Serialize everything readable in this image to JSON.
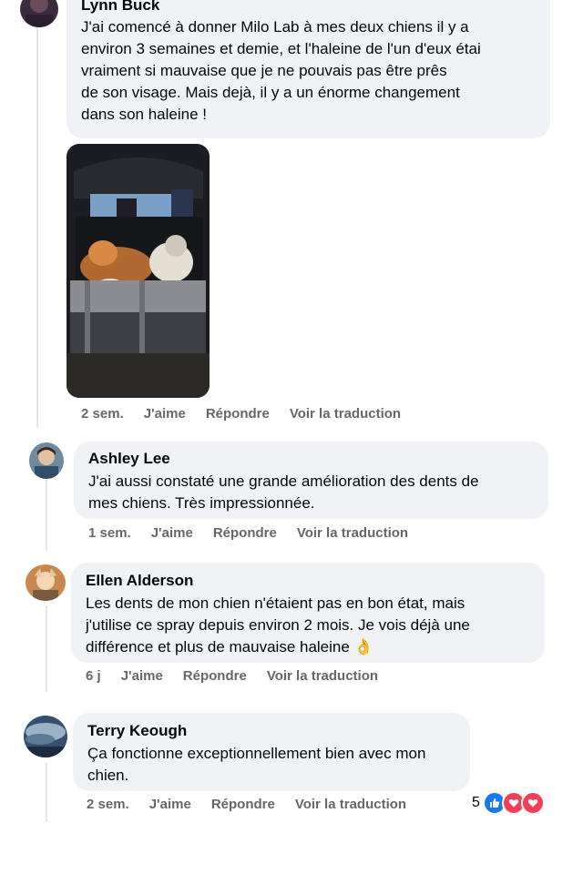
{
  "comments": [
    {
      "author": "Lynn Buck",
      "lines": [
        "J'ai comencé à donner Milo Lab à mes deux chiens il y a",
        "environ 3 semaines et demie, et l'haleine de l'un d'eux étai",
        "vraiment si mauvaise que je ne pouvais pas être prês",
        "de son visage. Mais dejà, il y a un énorme changement",
        "dans son haleine !"
      ],
      "time": "2 sem.",
      "like": "J'aime",
      "reply": "Répondre",
      "translate": "Voir la traduction"
    },
    {
      "author": "Ashley Lee",
      "lines": [
        "J'ai aussi constaté une grande amélioration des dents de",
        "mes chiens. Très impressionnée."
      ],
      "time": "1 sem.",
      "like": "J'aime",
      "reply": "Répondre",
      "translate": "Voir la traduction"
    },
    {
      "author": "Ellen Alderson",
      "lines": [
        "Les dents de mon chien n'étaient pas en bon état, mais",
        "j'utilise ce spray depuis environ 2 mois. Je vois déjà une",
        "différence et plus de mauvaise haleine 👌"
      ],
      "time": "6 j",
      "like": "J'aime",
      "reply": "Répondre",
      "translate": "Voir la traduction"
    },
    {
      "author": "Terry Keough",
      "lines": [
        "Ça fonctionne exceptionnellement bien avec mon",
        "chien."
      ],
      "time": "2 sem.",
      "like": "J'aime",
      "reply": "Répondre",
      "translate": "Voir la traduction",
      "reaction_count": "5"
    }
  ],
  "colors": {
    "bubble": "#f0f2f5",
    "meta_text": "#65676b",
    "like_blue": "#1877f2",
    "love_red": "#f33e58"
  },
  "icons": [
    "like-reaction-icon",
    "love-reaction-icon",
    "care-reaction-icon"
  ]
}
